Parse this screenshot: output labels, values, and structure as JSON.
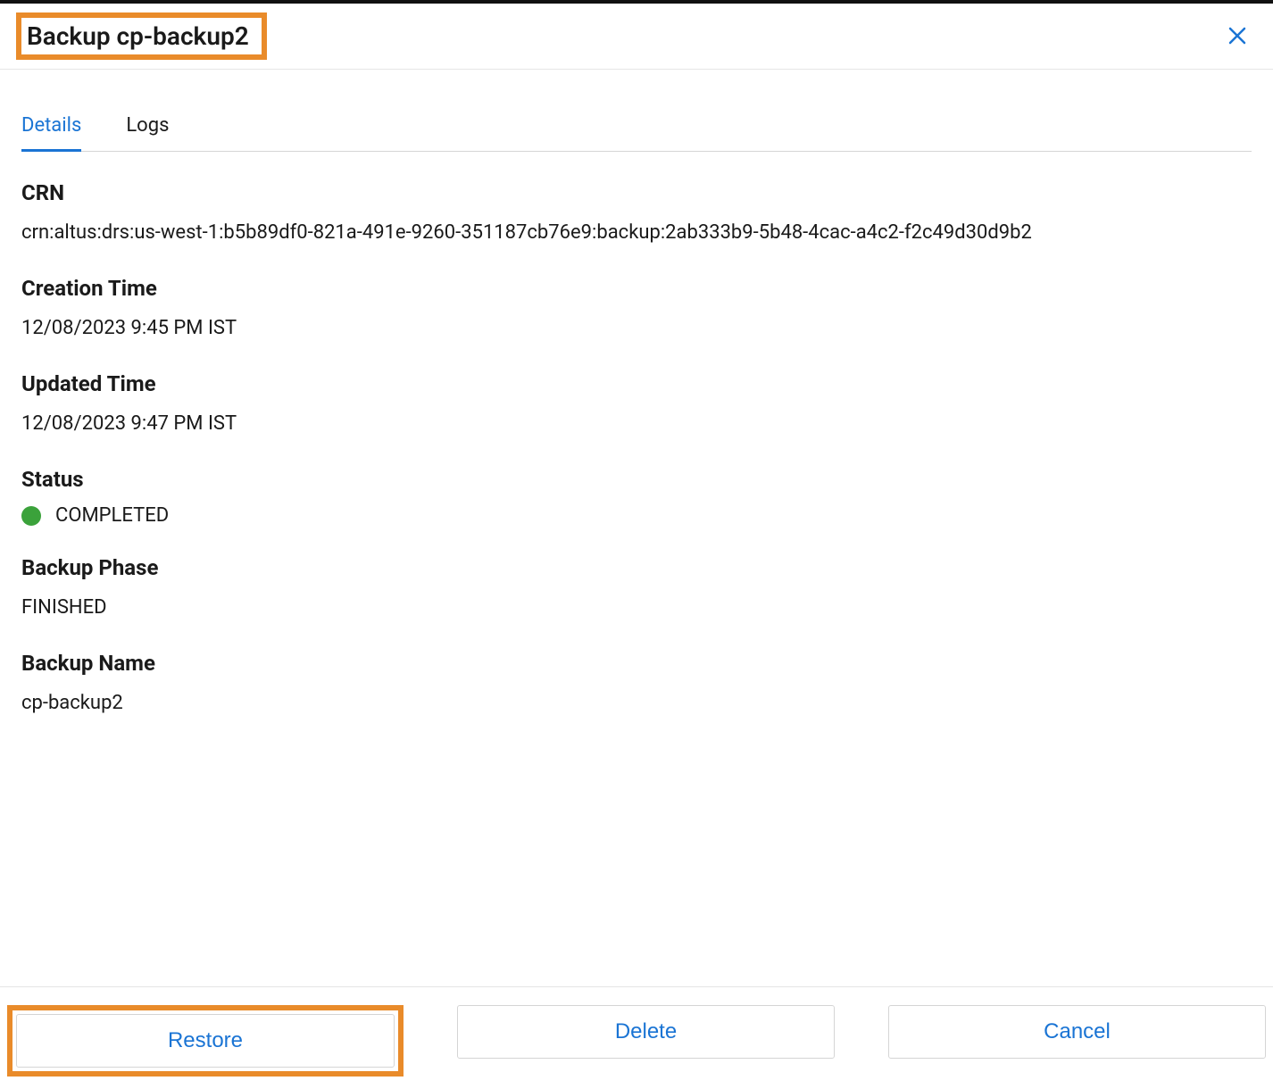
{
  "header": {
    "title": "Backup cp-backup2"
  },
  "tabs": {
    "details": "Details",
    "logs": "Logs"
  },
  "details": {
    "crn_label": "CRN",
    "crn_value": "crn:altus:drs:us-west-1:b5b89df0-821a-491e-9260-351187cb76e9:backup:2ab333b9-5b48-4cac-a4c2-f2c49d30d9b2",
    "creation_time_label": "Creation Time",
    "creation_time_value": "12/08/2023 9:45 PM IST",
    "updated_time_label": "Updated Time",
    "updated_time_value": "12/08/2023 9:47 PM IST",
    "status_label": "Status",
    "status_value": "COMPLETED",
    "status_color": "#3ba23b",
    "backup_phase_label": "Backup Phase",
    "backup_phase_value": "FINISHED",
    "backup_name_label": "Backup Name",
    "backup_name_value": "cp-backup2"
  },
  "footer": {
    "restore": "Restore",
    "delete": "Delete",
    "cancel": "Cancel"
  }
}
